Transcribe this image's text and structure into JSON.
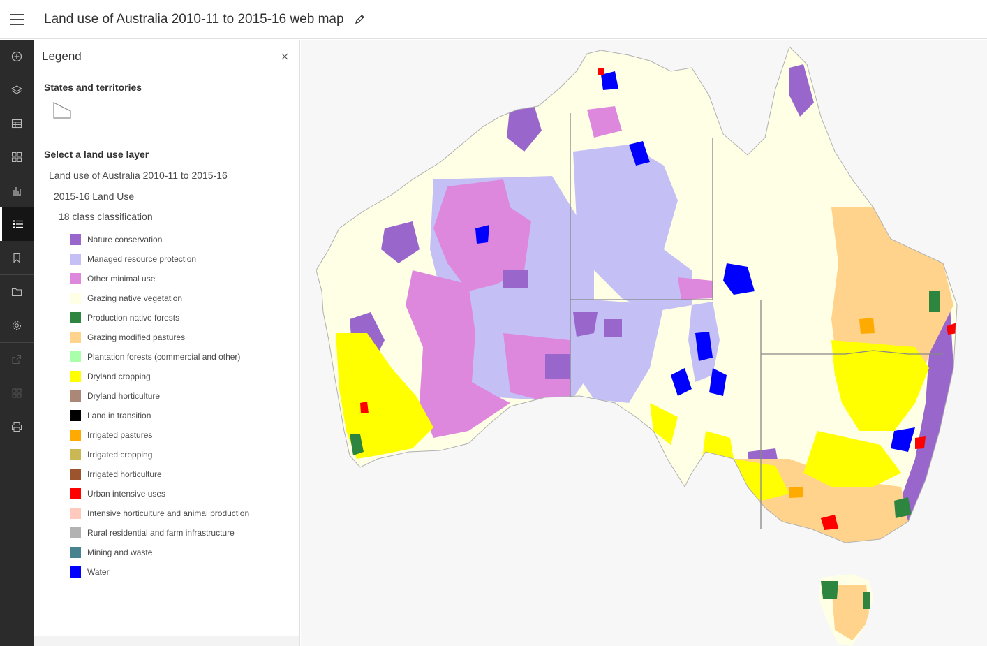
{
  "header": {
    "title": "Land use of Australia 2010-11 to 2015-16 web map"
  },
  "actionbar": {
    "items": [
      {
        "icon": "plus-circle-icon",
        "tooltip": "Add"
      },
      {
        "icon": "layers-icon"
      },
      {
        "icon": "table-icon"
      },
      {
        "icon": "basemap-icon"
      },
      {
        "icon": "chart-icon"
      },
      {
        "icon": "legend-icon",
        "active": true
      },
      {
        "icon": "bookmark-icon"
      },
      {
        "icon": "folder-icon"
      },
      {
        "icon": "gear-icon"
      },
      {
        "icon": "share-icon",
        "disabled": true
      },
      {
        "icon": "grid-icon",
        "disabled": true
      },
      {
        "icon": "print-icon"
      }
    ]
  },
  "legend": {
    "title": "Legend",
    "states_title": "States and territories",
    "select_title": "Select a land use layer",
    "tree_level_1": "Land use of Australia 2010-11 to 2015-16",
    "tree_level_2": "2015-16 Land Use",
    "tree_level_3": "18 class classification",
    "classes": [
      {
        "label": "Nature conservation",
        "color": "#9966cc"
      },
      {
        "label": "Managed resource protection",
        "color": "#c4c0f5"
      },
      {
        "label": "Other minimal use",
        "color": "#dd88dd"
      },
      {
        "label": "Grazing native vegetation",
        "color": "#ffffe5"
      },
      {
        "label": "Production native forests",
        "color": "#2e8540"
      },
      {
        "label": "Grazing modified pastures",
        "color": "#ffd38c"
      },
      {
        "label": "Plantation forests (commercial and other)",
        "color": "#aaffaa"
      },
      {
        "label": "Dryland cropping",
        "color": "#ffff00"
      },
      {
        "label": "Dryland horticulture",
        "color": "#ab8778"
      },
      {
        "label": "Land in transition",
        "color": "#000000"
      },
      {
        "label": "Irrigated pastures",
        "color": "#ffaa00"
      },
      {
        "label": "Irrigated cropping",
        "color": "#c9b854"
      },
      {
        "label": "Irrigated horticulture",
        "color": "#9c542e"
      },
      {
        "label": "Urban intensive uses",
        "color": "#ff0000"
      },
      {
        "label": "Intensive horticulture and animal production",
        "color": "#ffc9be"
      },
      {
        "label": "Rural residential and farm infrastructure",
        "color": "#b2b2b2"
      },
      {
        "label": "Mining and waste",
        "color": "#47828f"
      },
      {
        "label": "Water",
        "color": "#0000ff"
      }
    ]
  },
  "map": {
    "background": "#f7f7f7"
  }
}
